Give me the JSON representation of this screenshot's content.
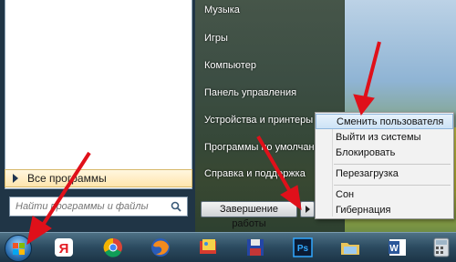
{
  "start_menu": {
    "all_programs_label": "Все программы",
    "search_placeholder": "Найти программы и файлы",
    "right_items": [
      {
        "label": "Музыка"
      },
      {
        "label": "Игры"
      },
      {
        "label": "Компьютер"
      },
      {
        "label": "Панель управления"
      },
      {
        "label": "Устройства и принтеры"
      },
      {
        "label": "Программы по умолчанию"
      },
      {
        "label": "Справка и поддержка"
      }
    ],
    "shutdown_label": "Завершение работы"
  },
  "shutdown_flyout": {
    "items": [
      {
        "label": "Сменить пользователя",
        "highlighted": true
      },
      {
        "label": "Выйти из системы"
      },
      {
        "label": "Блокировать"
      },
      {
        "label": "Перезагрузка"
      },
      {
        "label": "Сон"
      },
      {
        "label": "Гибернация"
      }
    ]
  },
  "taskbar": {
    "icons": [
      "windows-start-orb",
      "yandex-browser-icon",
      "chrome-icon",
      "firefox-icon",
      "picture-manager-icon",
      "save-floppy-icon",
      "photoshop-icon",
      "explorer-folder-icon",
      "word-icon",
      "calculator-icon"
    ]
  },
  "colors": {
    "annotation_arrow": "#e0101a",
    "taskbar": "#2b4a5f",
    "flyout_highlight": "#cde3f6"
  }
}
